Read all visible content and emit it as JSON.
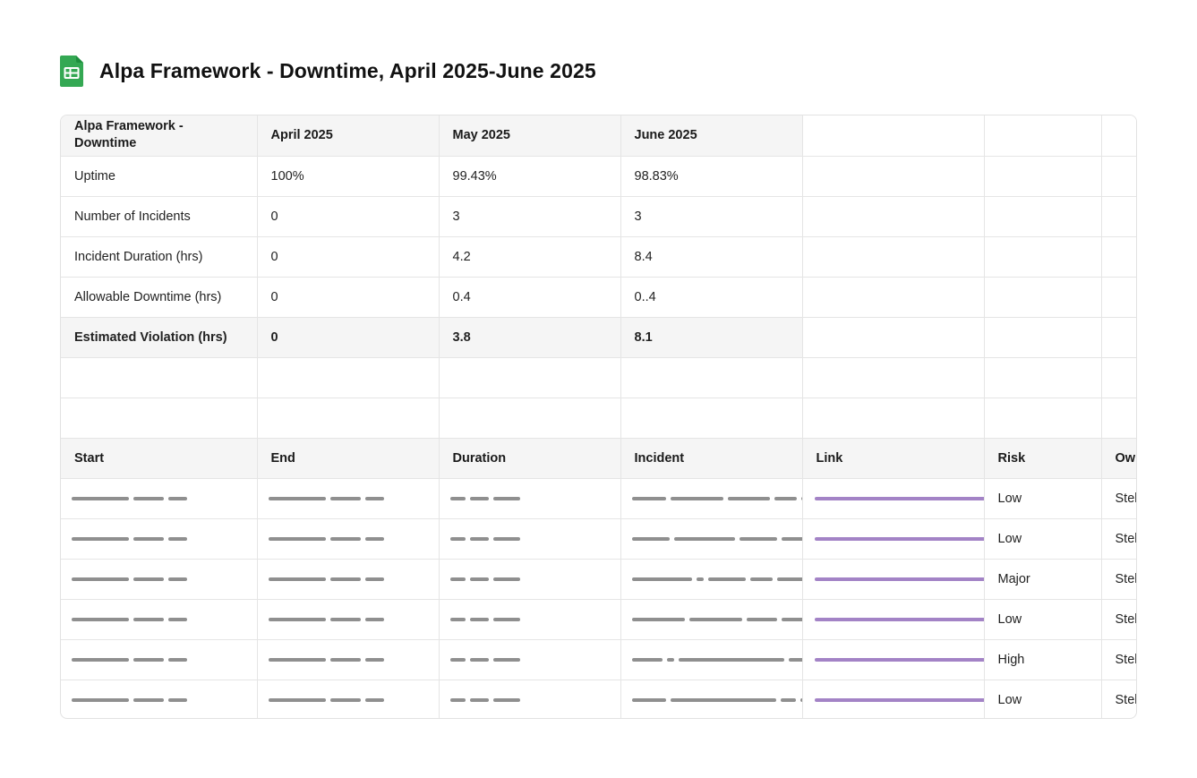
{
  "title": "Alpa Framework - Downtime, April 2025-June 2025",
  "icon": "google-sheets-icon",
  "colors": {
    "sheet_icon": "#34a853",
    "link_bar": "#a383c6",
    "placeholder_bar": "#8f8f8f",
    "header_bg": "#f5f5f5"
  },
  "summary": {
    "headers": [
      "Alpa Framework - Downtime",
      "April 2025",
      "May 2025",
      "June 2025"
    ],
    "rows": [
      {
        "label": "Uptime",
        "values": [
          "100%",
          "99.43%",
          "98.83%"
        ]
      },
      {
        "label": "Number of Incidents",
        "values": [
          "0",
          "3",
          "3"
        ]
      },
      {
        "label": "Incident Duration (hrs)",
        "values": [
          "0",
          "4.2",
          "8.4"
        ]
      },
      {
        "label": "Allowable Downtime (hrs)",
        "values": [
          "0",
          "0.4",
          "0..4"
        ]
      },
      {
        "label": "Estimated Violation (hrs)",
        "values": [
          "0",
          "3.8",
          "8.1"
        ]
      }
    ]
  },
  "incidents": {
    "headers": [
      "Start",
      "End",
      "Duration",
      "Incident",
      "Link",
      "Risk",
      "Ow"
    ],
    "rows": [
      {
        "risk": "Low",
        "owner": "Stel"
      },
      {
        "risk": "Low",
        "owner": "Stel"
      },
      {
        "risk": "Major",
        "owner": "Stel"
      },
      {
        "risk": "Low",
        "owner": "Stel"
      },
      {
        "risk": "High",
        "owner": "Stel"
      },
      {
        "risk": "Low",
        "owner": "Stel"
      }
    ]
  }
}
